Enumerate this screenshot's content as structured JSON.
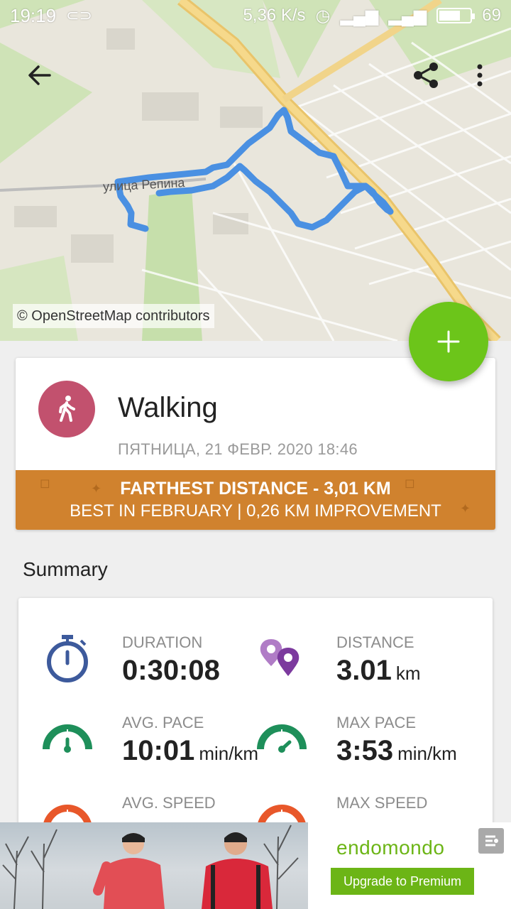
{
  "status_bar": {
    "time": "19:19",
    "sync_icon": "link-icon",
    "network_speed": "5,36 K/s",
    "battery_level": "69",
    "battery_fraction": 0.69
  },
  "map": {
    "credit": "© OpenStreetMap contributors",
    "street_label": "улица Репина",
    "route_color": "#4a90e2"
  },
  "toolbar": {
    "back_icon": "arrow-left-icon",
    "share_icon": "share-icon",
    "more_icon": "more-vert-icon"
  },
  "fab": {
    "icon": "plus-icon",
    "color": "#6cc51a"
  },
  "workout": {
    "sport": "Walking",
    "sport_icon": "walking-person-icon",
    "sport_color": "#c2516e",
    "date": "ПЯТНИЦА, 21 ФЕВР. 2020 18:46",
    "record": {
      "line1": "FARTHEST DISTANCE  -  3,01 KM",
      "line2": "BEST IN FEBRUARY  |  0,26 KM IMPROVEMENT",
      "color": "#d0822e"
    }
  },
  "summary": {
    "title": "Summary",
    "stats": [
      {
        "label": "DURATION",
        "value": "0:30:08",
        "unit": "",
        "icon": "stopwatch-icon"
      },
      {
        "label": "DISTANCE",
        "value": "3.01",
        "unit": "km",
        "icon": "map-pins-icon"
      },
      {
        "label": "AVG. PACE",
        "value": "10:01",
        "unit": "min/km",
        "icon": "speedometer-icon"
      },
      {
        "label": "MAX PACE",
        "value": "3:53",
        "unit": "min/km",
        "icon": "speedometer-icon"
      },
      {
        "label": "AVG. SPEED",
        "value": "",
        "unit": "",
        "icon": "speedometer-icon"
      },
      {
        "label": "MAX SPEED",
        "value": "",
        "unit": "",
        "icon": "speedometer-icon"
      }
    ]
  },
  "ad": {
    "brand": "endomondo",
    "cta": "Upgrade to Premium",
    "close_icon": "ad-choices-icon"
  }
}
